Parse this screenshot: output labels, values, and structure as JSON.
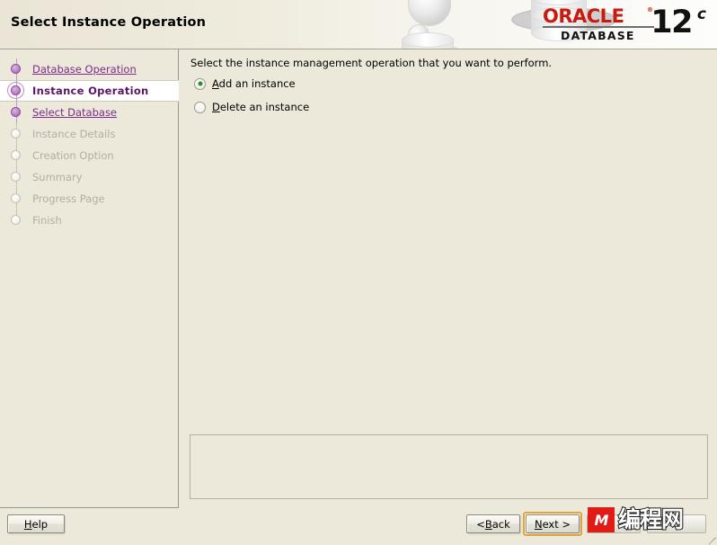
{
  "header": {
    "title": "Select Instance Operation",
    "logo": {
      "brand": "ORACLE",
      "registered": "®",
      "product": "DATABASE",
      "version": "12",
      "edition": "c"
    }
  },
  "sidebar": {
    "steps": [
      {
        "label": "Database Operation",
        "state": "done"
      },
      {
        "label": "Instance Operation",
        "state": "current"
      },
      {
        "label": "Select Database",
        "state": "done"
      },
      {
        "label": "Instance Details",
        "state": "future"
      },
      {
        "label": "Creation Option",
        "state": "future"
      },
      {
        "label": "Summary",
        "state": "future"
      },
      {
        "label": "Progress Page",
        "state": "future"
      },
      {
        "label": "Finish",
        "state": "future"
      }
    ]
  },
  "content": {
    "instruction": "Select the instance management operation that you want to perform.",
    "options": [
      {
        "label_before": "",
        "mnemonic": "A",
        "label_after": "dd an instance",
        "selected": true
      },
      {
        "label_before": "",
        "mnemonic": "D",
        "label_after": "elete an instance",
        "selected": false
      }
    ],
    "message_box_text": ""
  },
  "buttons": {
    "help": {
      "mnemonic": "H",
      "rest": "elp"
    },
    "back": {
      "prefix": "< ",
      "mnemonic": "B",
      "rest": "ack"
    },
    "next": {
      "mnemonic": "N",
      "rest": "ext >"
    }
  },
  "watermark": {
    "mark": "M",
    "text": "编程网"
  },
  "colors": {
    "window_background": "#ece8da",
    "oracle_red": "#ca1a10",
    "step_link": "#7d2a8c",
    "step_current": "#5a1566",
    "step_disabled": "#b3aea2",
    "radio_selected": "#1f8f2f",
    "focus_ring": "#e2a53a",
    "watermark_red": "#e11b16"
  }
}
